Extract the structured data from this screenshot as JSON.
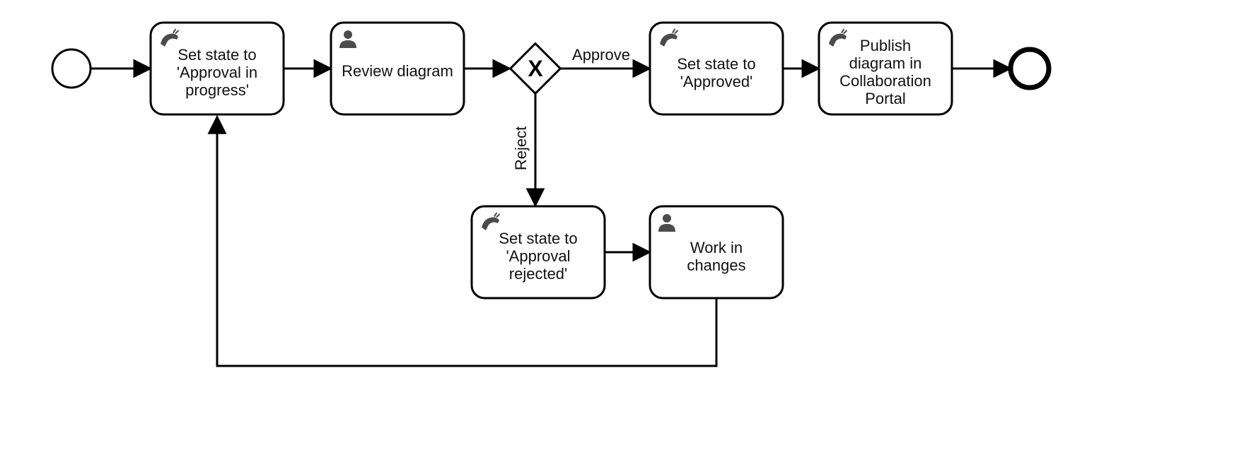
{
  "diagram": {
    "type": "BPMN process",
    "start_event": {
      "kind": "start"
    },
    "end_event": {
      "kind": "end"
    },
    "gateway": {
      "kind": "exclusive",
      "marker": "X"
    },
    "tasks": {
      "set_approval_in_progress": {
        "label_lines": [
          "Set state to",
          "'Approval in",
          "progress'"
        ],
        "icon": "antelope",
        "type": "service"
      },
      "review_diagram": {
        "label_lines": [
          "Review diagram"
        ],
        "icon": "user",
        "type": "user"
      },
      "set_approved": {
        "label_lines": [
          "Set state to",
          "'Approved'"
        ],
        "icon": "antelope",
        "type": "service"
      },
      "publish": {
        "label_lines": [
          "Publish",
          "diagram in",
          "Collaboration",
          "Portal"
        ],
        "icon": "antelope",
        "type": "service"
      },
      "set_rejected": {
        "label_lines": [
          "Set state to",
          "'Approval",
          "rejected'"
        ],
        "icon": "antelope",
        "type": "service"
      },
      "work_in_changes": {
        "label_lines": [
          "Work in",
          "changes"
        ],
        "icon": "user",
        "type": "user"
      }
    },
    "flows": {
      "approve": {
        "label": "Approve"
      },
      "reject": {
        "label": "Reject"
      }
    }
  }
}
